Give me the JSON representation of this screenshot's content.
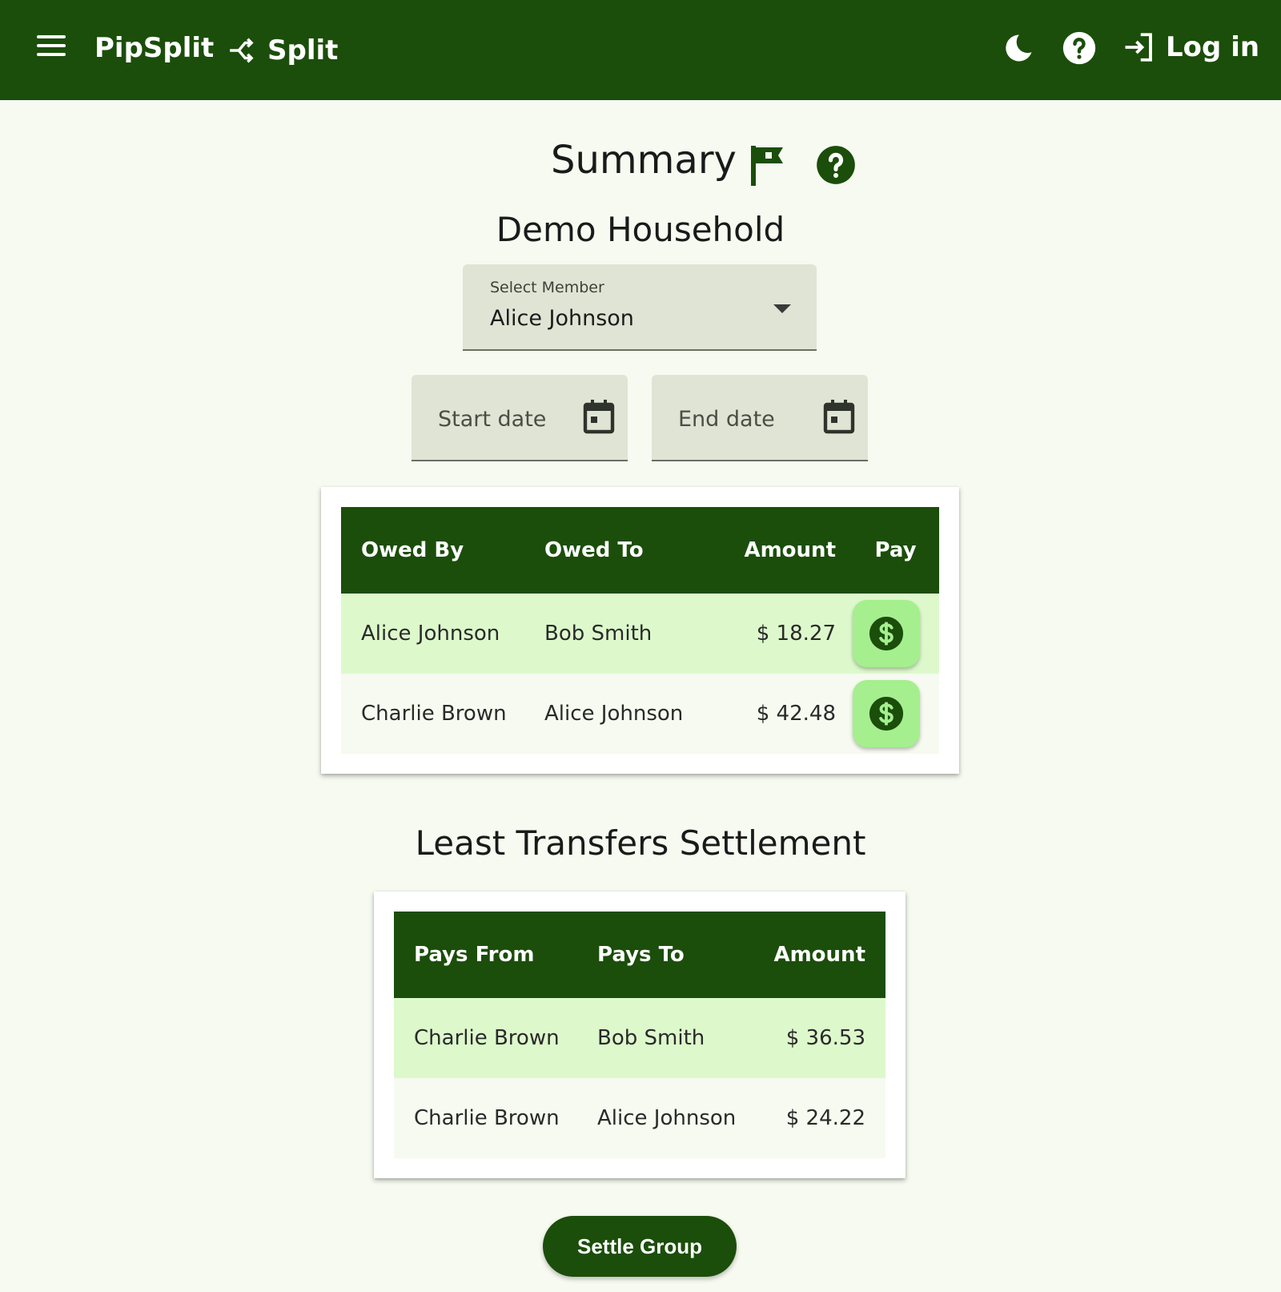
{
  "nav": {
    "brand": "PipSplit",
    "split_label": "Split",
    "login_label": "Log in"
  },
  "page": {
    "title": "Summary",
    "group_name": "Demo Household"
  },
  "filters": {
    "member_select_label": "Select Member",
    "member_selected": "Alice Johnson",
    "start_date_placeholder": "Start date",
    "end_date_placeholder": "End date"
  },
  "debts_table": {
    "headers": [
      "Owed By",
      "Owed To",
      "Amount",
      "Pay"
    ],
    "rows": [
      {
        "owed_by": "Alice Johnson",
        "owed_to": "Bob Smith",
        "amount": "$ 18.27"
      },
      {
        "owed_by": "Charlie Brown",
        "owed_to": "Alice Johnson",
        "amount": "$ 42.48"
      }
    ]
  },
  "settlement": {
    "title": "Least Transfers Settlement",
    "headers": [
      "Pays From",
      "Pays To",
      "Amount"
    ],
    "rows": [
      {
        "from": "Charlie Brown",
        "to": "Bob Smith",
        "amount": "$ 36.53"
      },
      {
        "from": "Charlie Brown",
        "to": "Alice Johnson",
        "amount": "$ 24.22"
      }
    ],
    "button_label": "Settle Group"
  },
  "colors": {
    "primary": "#1b4e0a",
    "row_highlight": "#ddf9cc",
    "pay_button": "#a5ef8f",
    "background": "#f6faf0"
  },
  "icons": [
    "menu-icon",
    "split-icon",
    "dark-mode-icon",
    "help-icon",
    "login-icon",
    "flag-icon",
    "calendar-icon",
    "dollar-icon"
  ]
}
